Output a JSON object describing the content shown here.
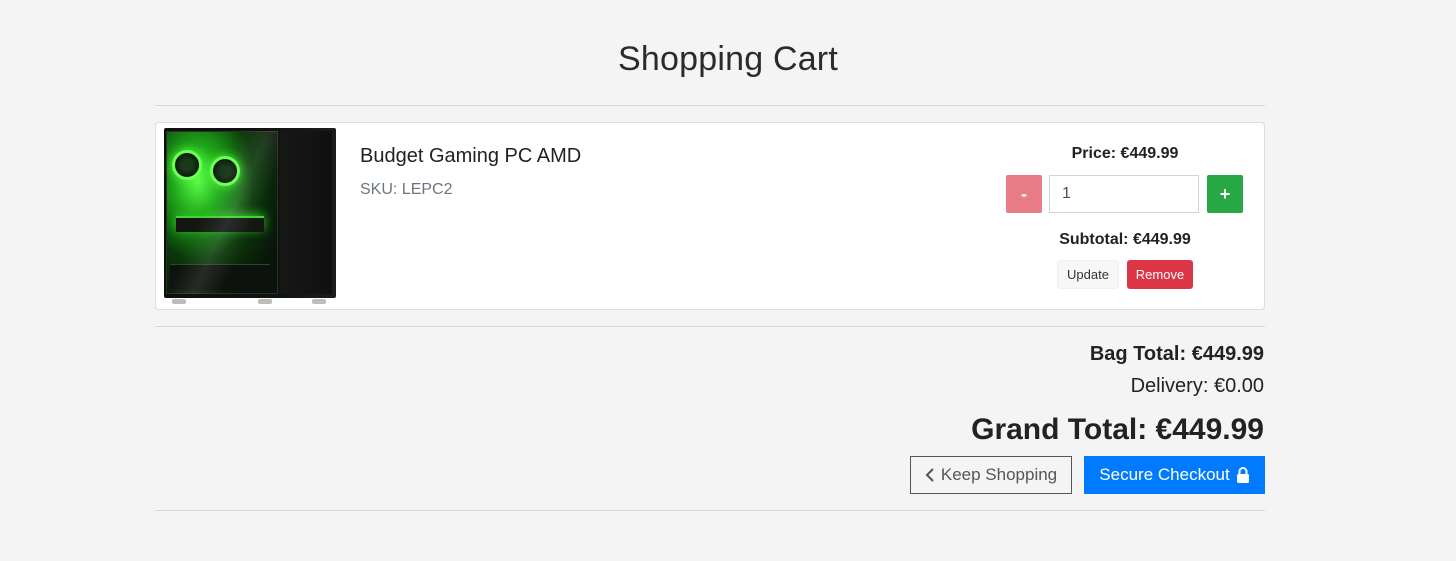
{
  "page": {
    "title": "Shopping Cart"
  },
  "cart": {
    "items": [
      {
        "name": "Budget Gaming PC AMD",
        "sku": "SKU: LEPC2",
        "price": "Price: €449.99",
        "quantity": "1",
        "subtotal": "Subtotal: €449.99",
        "update_label": "Update",
        "remove_label": "Remove",
        "minus_label": "-",
        "plus_label": "+",
        "image_icon": "gaming-pc-image"
      }
    ]
  },
  "summary": {
    "bag_total": "Bag Total: €449.99",
    "delivery": "Delivery: €0.00",
    "grand_total": "Grand Total: €449.99"
  },
  "actions": {
    "keep_shopping": "Keep Shopping",
    "keep_shopping_icon": "chevron-left-icon",
    "checkout": "Secure Checkout",
    "checkout_icon": "lock-icon"
  },
  "colors": {
    "background": "#f4f4f4",
    "minus": "#e77c86",
    "plus": "#28a745",
    "remove": "#dc3545",
    "checkout": "#007bff"
  }
}
